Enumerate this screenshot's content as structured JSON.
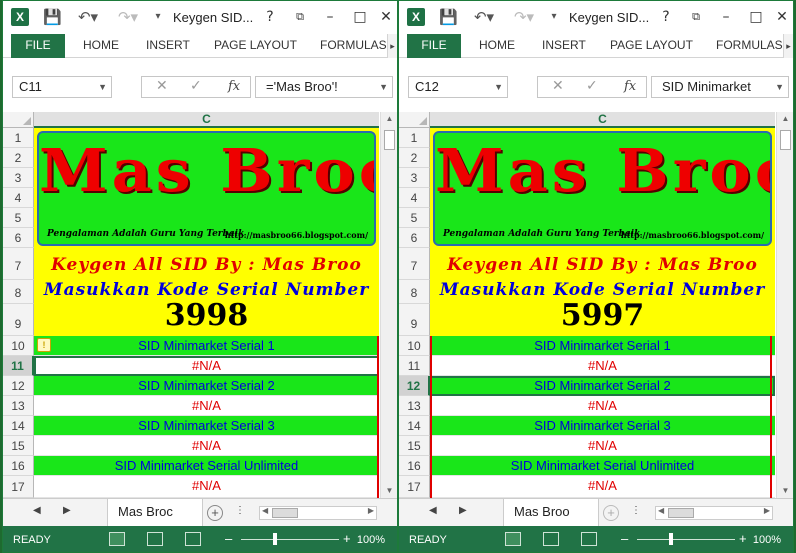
{
  "windows": [
    {
      "title": "Keygen SID...",
      "tabs": [
        "FILE",
        "HOME",
        "INSERT",
        "PAGE LAYOUT",
        "FORMULAS"
      ],
      "name_box": "C11",
      "formula": "='Mas Broo'!",
      "column": "C",
      "rows": [
        "1",
        "2",
        "3",
        "4",
        "5",
        "6",
        "7",
        "8",
        "9",
        "10",
        "11",
        "12",
        "13",
        "14",
        "15",
        "16",
        "17"
      ],
      "selected_row": "11",
      "logo": "Mas Broo",
      "tagline": "Pengalaman Adalah Guru Yang Terbaik",
      "website": "http://masbroo66.blogspot.com/",
      "keygen_title": "Keygen All SID By : Mas Broo",
      "serial_prompt": "Masukkan Kode Serial Number",
      "code": "3998",
      "serial_rows": [
        "SID Minimarket Serial 1",
        "#N/A",
        "SID Minimarket Serial 2",
        "#N/A",
        "SID Minimarket Serial 3",
        "#N/A",
        "SID Minimarket Serial Unlimited",
        "#N/A"
      ],
      "sheet_tab": "Mas Broc",
      "status": "READY",
      "zoom": "100%"
    },
    {
      "title": "Keygen SID...",
      "tabs": [
        "FILE",
        "HOME",
        "INSERT",
        "PAGE LAYOUT",
        "FORMULAS"
      ],
      "name_box": "C12",
      "formula": "SID Minimarket",
      "column": "C",
      "rows": [
        "1",
        "2",
        "3",
        "4",
        "5",
        "6",
        "7",
        "8",
        "9",
        "10",
        "11",
        "12",
        "13",
        "14",
        "15",
        "16",
        "17"
      ],
      "selected_row": "12",
      "logo": "Mas Broo",
      "tagline": "Pengalaman Adalah Guru Yang Terbaik",
      "website": "http://masbroo66.blogspot.com/",
      "keygen_title": "Keygen All SID By : Mas Broo",
      "serial_prompt": "Masukkan Kode Serial Number",
      "code": "5997",
      "serial_rows": [
        "SID Minimarket Serial 1",
        "#N/A",
        "SID Minimarket Serial 2",
        "#N/A",
        "SID Minimarket Serial 3",
        "#N/A",
        "SID Minimarket Serial Unlimited",
        "#N/A"
      ],
      "sheet_tab": "Mas Broo",
      "status": "READY",
      "zoom": "100%"
    }
  ],
  "colors": {
    "accent": "#217346",
    "green_cell": "#19e619",
    "yellow_cell": "#ffff00",
    "red_text": "#e00000",
    "blue_text": "#0000dd"
  },
  "icons": [
    "excel-logo-icon",
    "save-icon",
    "undo-icon",
    "redo-icon",
    "help-icon",
    "restore-icon",
    "minimize-icon",
    "close-icon",
    "cancel-icon",
    "enter-icon",
    "function-icon",
    "warning-icon",
    "plus-icon"
  ]
}
